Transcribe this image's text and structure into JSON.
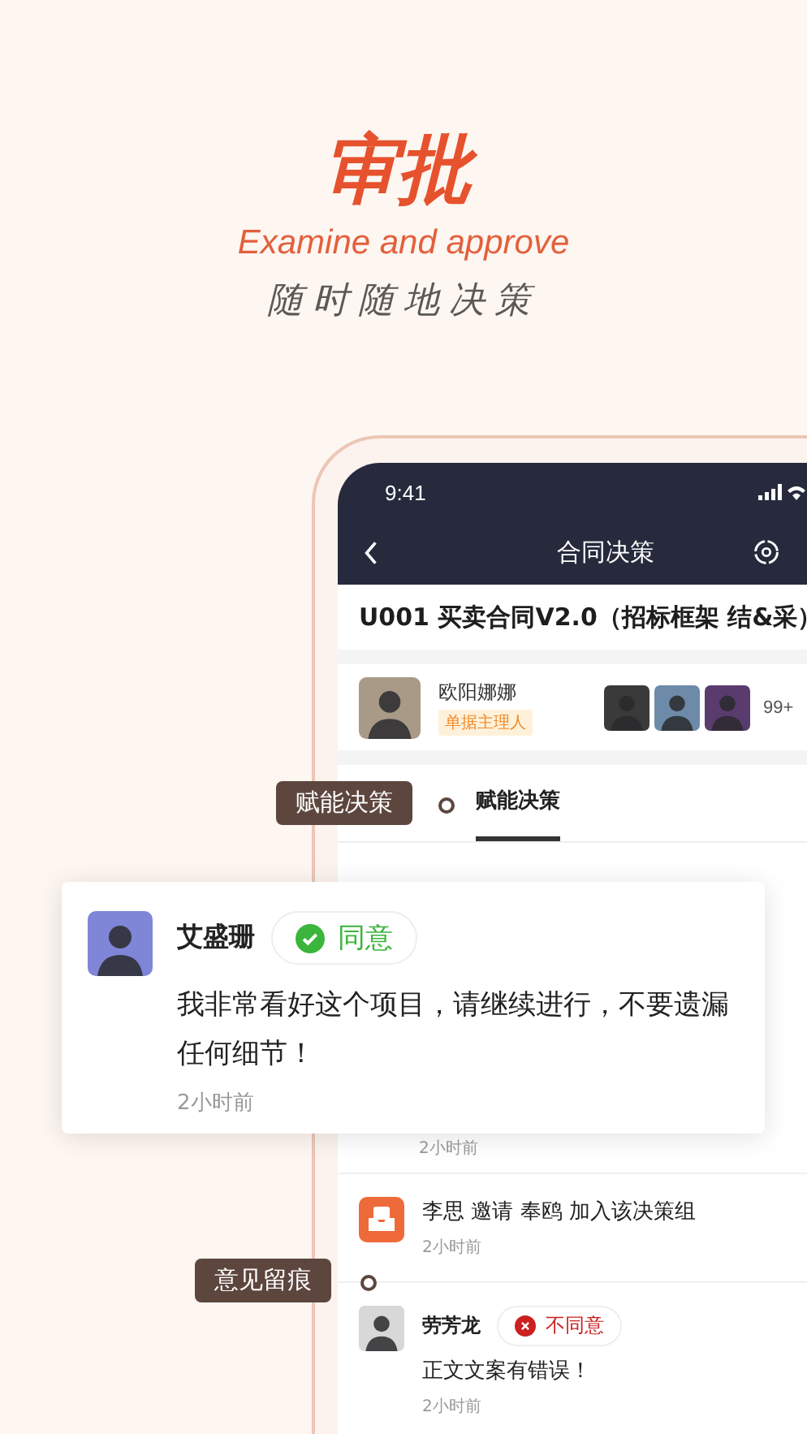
{
  "hero": {
    "title": "审批",
    "subtitle": "Examine and approve",
    "tagline": "随时随地决策"
  },
  "phone": {
    "status_bar": {
      "time": "9:41"
    },
    "nav": {
      "title": "合同决策"
    },
    "contract_title": "U001 买卖合同V2.0（招标框架 结&采）",
    "owner": {
      "name": "欧阳娜娜",
      "role": "单据主理人"
    },
    "members_count": "99+",
    "tabs": [
      {
        "label": "赋能决策",
        "selected": true
      }
    ],
    "feed": [
      {
        "kind": "covered",
        "time": "2小时前"
      },
      {
        "kind": "event",
        "text": "李思 邀请 奉鸥 加入该决策组",
        "time": "2小时前"
      },
      {
        "kind": "opinion",
        "name": "劳芳龙",
        "agreed": false,
        "verdict_label": "不同意",
        "comment": "正文文案有错误！",
        "time": "2小时前"
      }
    ]
  },
  "callouts": [
    {
      "label": "赋能决策"
    },
    {
      "label": "意见留痕"
    }
  ],
  "featured_comment": {
    "name": "艾盛珊",
    "agreed": true,
    "verdict_label": "同意",
    "comment": "我非常看好这个项目，请继续进行，不要遗漏任何细节！",
    "time": "2小时前"
  }
}
